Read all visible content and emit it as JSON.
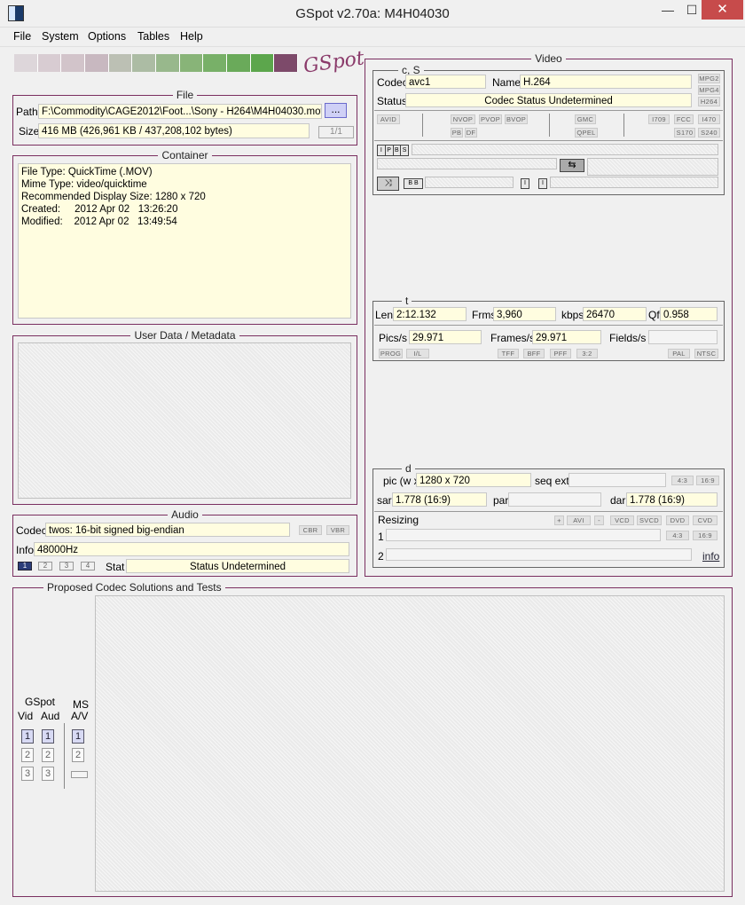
{
  "window": {
    "title": "GSpot v2.70a: M4H04030",
    "min": "—",
    "max": "☐",
    "close": "✕"
  },
  "menu": [
    "File",
    "System",
    "Options",
    "Tables",
    "Help"
  ],
  "logo": {
    "text": "GSpot",
    "bar_colors": [
      "#ddd6da",
      "#d8ccd2",
      "#d2c4ca",
      "#c8b8c0",
      "#bcc0b4",
      "#acbca4",
      "#98b88c",
      "#88b478",
      "#78b068",
      "#6aaa5a",
      "#5ca64c",
      "#7d4a6a"
    ]
  },
  "file": {
    "title": "File",
    "path_label": "Path",
    "path_value": "F:\\Commodity\\CAGE2012\\Foot...\\Sony - H264\\M4H04030.mov",
    "browse_label": "...",
    "size_label": "Size",
    "size_value": "416 MB (426,961 KB / 437,208,102 bytes)",
    "page": "1/1"
  },
  "container": {
    "title": "Container",
    "lines": [
      "File Type: QuickTime (.MOV)",
      "Mime Type: video/quicktime",
      "Recommended Display Size: 1280 x 720",
      "Created:     2012 Apr 02   13:26:20",
      "Modified:    2012 Apr 02   13:49:54"
    ]
  },
  "user_data": {
    "title": "User Data / Metadata"
  },
  "audio": {
    "title": "Audio",
    "codec_label": "Codec",
    "codec_value": "twos: 16-bit signed big-endian",
    "cbr": "CBR",
    "vbr": "VBR",
    "info_label": "Info",
    "info_value": "48000Hz",
    "streams": [
      "1",
      "2",
      "3",
      "4"
    ],
    "stat_label": "Stat",
    "stat_value": "Status Undetermined"
  },
  "video": {
    "title": "Video",
    "cs_title": "c, S",
    "codec_label": "Codec",
    "codec_value": "avc1",
    "name_label": "Name",
    "name_value": "H.264",
    "status_label": "Status",
    "status_value": "Codec Status Undetermined",
    "tags_right": [
      "MPG2",
      "MPG4",
      "H264"
    ],
    "flags_row1": [
      "AVID",
      "NVOP",
      "PVOP",
      "BVOP",
      "GMC",
      "I709",
      "FCC",
      "I470"
    ],
    "flags_row2": [
      "PB",
      "DF",
      "QPEL",
      "S170",
      "S240"
    ],
    "frame_types": [
      "I",
      "P",
      "B",
      "S"
    ],
    "t_title": "t",
    "len_label": "Len",
    "len_value": "2:12.132",
    "frms_label": "Frms",
    "frms_value": "3,960",
    "kbps_label": "kbps",
    "kbps_value": "26470",
    "qf_label": "Qf",
    "qf_value": "0.958",
    "pics_label": "Pics/s",
    "pics_value": "29.971",
    "frames_label": "Frames/s",
    "frames_value": "29.971",
    "fields_label": "Fields/s",
    "fields_value": "",
    "scan_flags": [
      "PROG",
      "I/L",
      "TFF",
      "BFF",
      "PFF",
      "3:2",
      "PAL",
      "NTSC"
    ],
    "d_title": "d",
    "pic_label": "pic (w x",
    "pic_value": "1280 x 720",
    "seq_label": "seq ext",
    "seq_value": "",
    "aspect_flags": [
      "4:3",
      "16:9"
    ],
    "sar_label": "sar",
    "sar_value": "1.778 (16:9)",
    "par_label": "par",
    "par_value": "",
    "dar_label": "dar",
    "dar_value": "1.778 (16:9)",
    "resizing_label": "Resizing",
    "resize_buttons": [
      "+",
      "AVI",
      "-",
      "VCD",
      "SVCD",
      "DVD",
      "CVD"
    ],
    "row1_label": "1",
    "row2_label": "2",
    "info_link": "info"
  },
  "proposed": {
    "title": "Proposed Codec Solutions and Tests",
    "gspot_label": "GSpot",
    "vid_label": "Vid",
    "aud_label": "Aud",
    "ms_label": "MS",
    "av_label": "A/V",
    "nums": [
      "1",
      "2",
      "3"
    ]
  }
}
